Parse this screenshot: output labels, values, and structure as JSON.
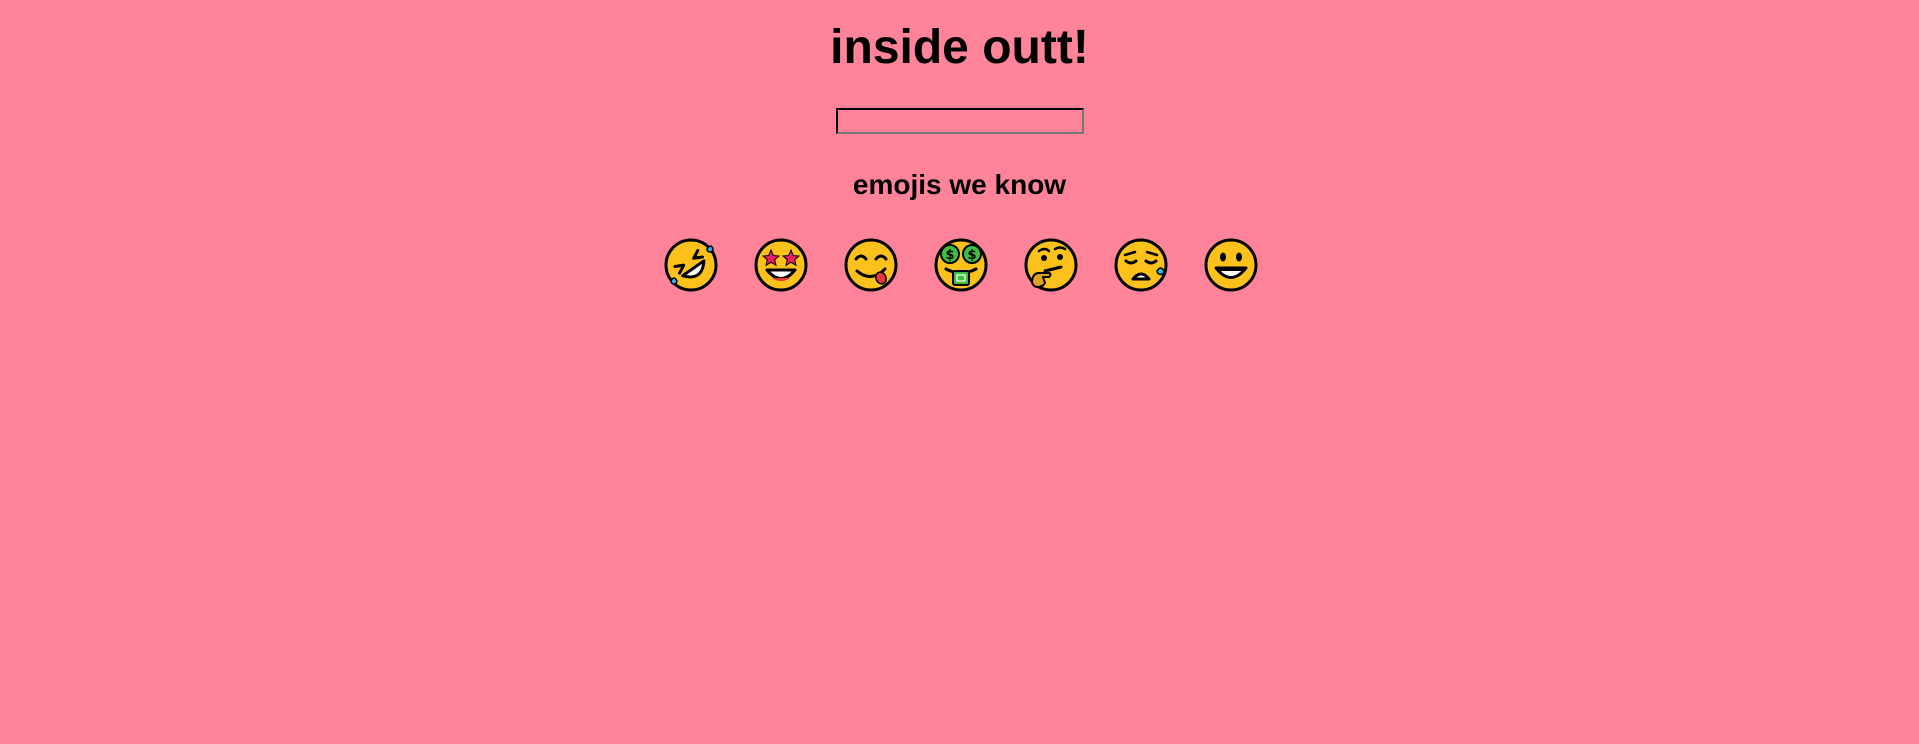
{
  "page": {
    "title": "inside outt!",
    "subtitle": "emojis we know",
    "background_color": "#ff8499"
  },
  "search": {
    "value": "",
    "placeholder": ""
  },
  "emojis": [
    {
      "icon": "rolling-on-floor-laughing-icon"
    },
    {
      "icon": "star-struck-icon"
    },
    {
      "icon": "face-savoring-food-icon"
    },
    {
      "icon": "money-mouth-face-icon"
    },
    {
      "icon": "thinking-face-icon"
    },
    {
      "icon": "sad-but-relieved-face-icon"
    },
    {
      "icon": "grinning-face-icon"
    }
  ],
  "colors": {
    "face": "#fcc21b",
    "outline": "#000000",
    "tear": "#29b6f6",
    "heart_eye": "#e91e63",
    "money": "#40c040",
    "tongue": "#e53935"
  }
}
